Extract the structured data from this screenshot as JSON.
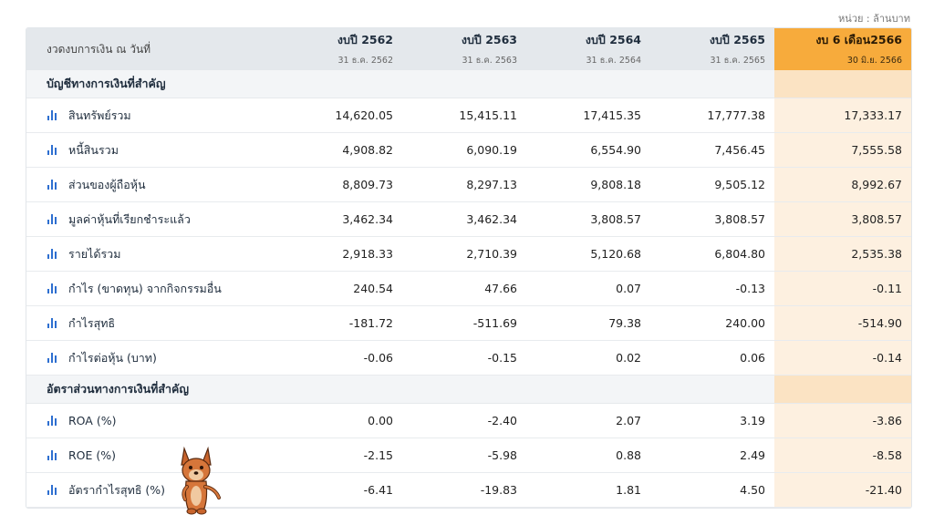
{
  "unit_note": "หน่วย : ล้านบาท",
  "header": {
    "label": "งวดงบการเงิน ณ วันที่",
    "columns": [
      {
        "year": "งบปี 2562",
        "date": "31 ธ.ค. 2562"
      },
      {
        "year": "งบปี 2563",
        "date": "31 ธ.ค. 2563"
      },
      {
        "year": "งบปี 2564",
        "date": "31 ธ.ค. 2564"
      },
      {
        "year": "งบปี 2565",
        "date": "31 ธ.ค. 2565"
      },
      {
        "year": "งบ 6 เดือน2566",
        "date": "30 มิ.ย. 2566"
      }
    ]
  },
  "sections": [
    {
      "title": "บัญชีทางการเงินที่สำคัญ",
      "rows": [
        {
          "label": "สินทรัพย์รวม",
          "values": [
            "14,620.05",
            "15,415.11",
            "17,415.35",
            "17,777.38",
            "17,333.17"
          ]
        },
        {
          "label": "หนี้สินรวม",
          "values": [
            "4,908.82",
            "6,090.19",
            "6,554.90",
            "7,456.45",
            "7,555.58"
          ]
        },
        {
          "label": "ส่วนของผู้ถือหุ้น",
          "values": [
            "8,809.73",
            "8,297.13",
            "9,808.18",
            "9,505.12",
            "8,992.67"
          ]
        },
        {
          "label": "มูลค่าหุ้นที่เรียกชำระแล้ว",
          "values": [
            "3,462.34",
            "3,462.34",
            "3,808.57",
            "3,808.57",
            "3,808.57"
          ]
        },
        {
          "label": "รายได้รวม",
          "values": [
            "2,918.33",
            "2,710.39",
            "5,120.68",
            "6,804.80",
            "2,535.38"
          ]
        },
        {
          "label": "กำไร (ขาดทุน) จากกิจกรรมอื่น",
          "values": [
            "240.54",
            "47.66",
            "0.07",
            "-0.13",
            "-0.11"
          ]
        },
        {
          "label": "กำไรสุทธิ",
          "values": [
            "-181.72",
            "-511.69",
            "79.38",
            "240.00",
            "-514.90"
          ]
        },
        {
          "label": "กำไรต่อหุ้น (บาท)",
          "values": [
            "-0.06",
            "-0.15",
            "0.02",
            "0.06",
            "-0.14"
          ]
        }
      ]
    },
    {
      "title": "อัตราส่วนทางการเงินที่สำคัญ",
      "rows": [
        {
          "label": "ROA (%)",
          "values": [
            "0.00",
            "-2.40",
            "2.07",
            "3.19",
            "-3.86"
          ]
        },
        {
          "label": "ROE (%)",
          "values": [
            "-2.15",
            "-5.98",
            "0.88",
            "2.49",
            "-8.58"
          ]
        },
        {
          "label": "อัตรากำไรสุทธิ (%)",
          "values": [
            "-6.41",
            "-19.83",
            "1.81",
            "4.50",
            "-21.40"
          ]
        }
      ]
    }
  ],
  "icons": {
    "row_icon": "bar-chart-icon",
    "mascot": "dog-mascot"
  },
  "colors": {
    "highlight_header": "#f7ab3c",
    "highlight_cell": "#fdf0e0",
    "icon": "#2e6fd0",
    "header_bg": "#e4e8ec"
  }
}
